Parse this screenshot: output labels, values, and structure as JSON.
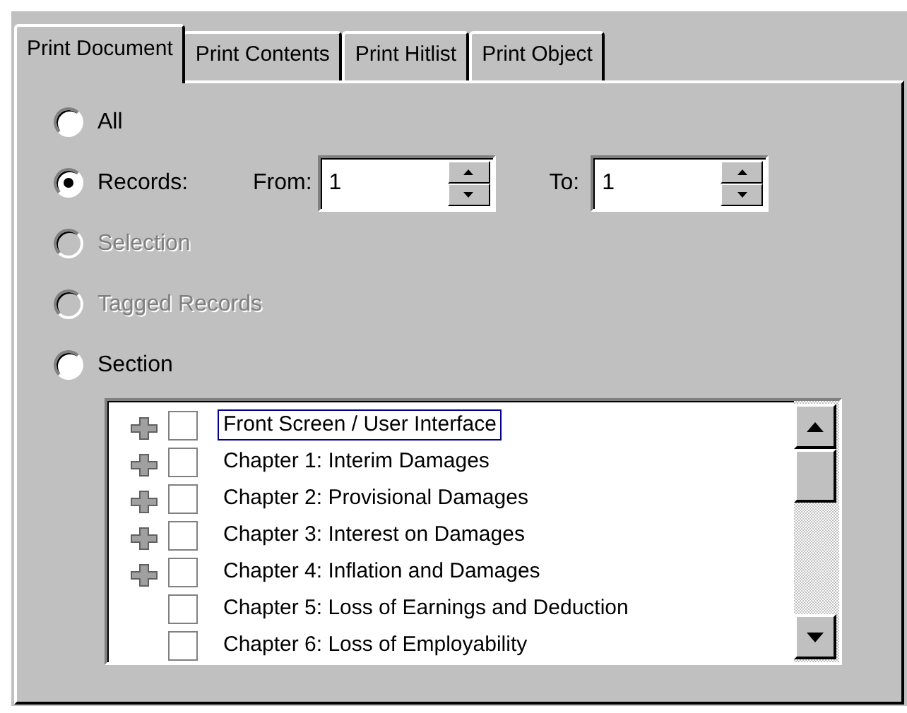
{
  "tabs": [
    {
      "label": "Print Document",
      "selected": true
    },
    {
      "label": "Print Contents",
      "selected": false
    },
    {
      "label": "Print Hitlist",
      "selected": false
    },
    {
      "label": "Print Object",
      "selected": false
    }
  ],
  "options": [
    {
      "label": "All",
      "selected": false,
      "disabled": false
    },
    {
      "label": "Records:",
      "selected": true,
      "disabled": false,
      "range": {
        "from_label": "From:",
        "from_value": "1",
        "to_label": "To:",
        "to_value": "1"
      }
    },
    {
      "label": "Selection",
      "selected": false,
      "disabled": true
    },
    {
      "label": "Tagged Records",
      "selected": false,
      "disabled": true
    },
    {
      "label": "Section",
      "selected": false,
      "disabled": false
    }
  ],
  "sections": [
    {
      "label": "Front Screen / User Interface",
      "expandable": true,
      "checked": false,
      "focused": true
    },
    {
      "label": "Chapter 1: Interim Damages",
      "expandable": true,
      "checked": false,
      "focused": false
    },
    {
      "label": "Chapter 2: Provisional Damages",
      "expandable": true,
      "checked": false,
      "focused": false
    },
    {
      "label": "Chapter 3: Interest on Damages",
      "expandable": true,
      "checked": false,
      "focused": false
    },
    {
      "label": "Chapter 4: Inflation and Damages",
      "expandable": true,
      "checked": false,
      "focused": false
    },
    {
      "label": "Chapter 5: Loss of Earnings and Deduction",
      "expandable": false,
      "checked": false,
      "focused": false
    },
    {
      "label": "Chapter 6: Loss of Employability",
      "expandable": false,
      "checked": false,
      "focused": false
    }
  ]
}
